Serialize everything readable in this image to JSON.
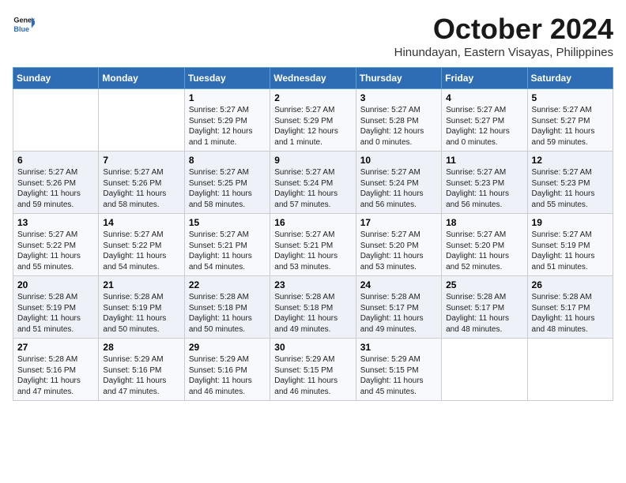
{
  "logo": {
    "line1": "General",
    "line2": "Blue"
  },
  "title": "October 2024",
  "subtitle": "Hinundayan, Eastern Visayas, Philippines",
  "days_of_week": [
    "Sunday",
    "Monday",
    "Tuesday",
    "Wednesday",
    "Thursday",
    "Friday",
    "Saturday"
  ],
  "weeks": [
    [
      {
        "day": "",
        "content": ""
      },
      {
        "day": "",
        "content": ""
      },
      {
        "day": "1",
        "content": "Sunrise: 5:27 AM\nSunset: 5:29 PM\nDaylight: 12 hours and 1 minute."
      },
      {
        "day": "2",
        "content": "Sunrise: 5:27 AM\nSunset: 5:29 PM\nDaylight: 12 hours and 1 minute."
      },
      {
        "day": "3",
        "content": "Sunrise: 5:27 AM\nSunset: 5:28 PM\nDaylight: 12 hours and 0 minutes."
      },
      {
        "day": "4",
        "content": "Sunrise: 5:27 AM\nSunset: 5:27 PM\nDaylight: 12 hours and 0 minutes."
      },
      {
        "day": "5",
        "content": "Sunrise: 5:27 AM\nSunset: 5:27 PM\nDaylight: 11 hours and 59 minutes."
      }
    ],
    [
      {
        "day": "6",
        "content": "Sunrise: 5:27 AM\nSunset: 5:26 PM\nDaylight: 11 hours and 59 minutes."
      },
      {
        "day": "7",
        "content": "Sunrise: 5:27 AM\nSunset: 5:26 PM\nDaylight: 11 hours and 58 minutes."
      },
      {
        "day": "8",
        "content": "Sunrise: 5:27 AM\nSunset: 5:25 PM\nDaylight: 11 hours and 58 minutes."
      },
      {
        "day": "9",
        "content": "Sunrise: 5:27 AM\nSunset: 5:24 PM\nDaylight: 11 hours and 57 minutes."
      },
      {
        "day": "10",
        "content": "Sunrise: 5:27 AM\nSunset: 5:24 PM\nDaylight: 11 hours and 56 minutes."
      },
      {
        "day": "11",
        "content": "Sunrise: 5:27 AM\nSunset: 5:23 PM\nDaylight: 11 hours and 56 minutes."
      },
      {
        "day": "12",
        "content": "Sunrise: 5:27 AM\nSunset: 5:23 PM\nDaylight: 11 hours and 55 minutes."
      }
    ],
    [
      {
        "day": "13",
        "content": "Sunrise: 5:27 AM\nSunset: 5:22 PM\nDaylight: 11 hours and 55 minutes."
      },
      {
        "day": "14",
        "content": "Sunrise: 5:27 AM\nSunset: 5:22 PM\nDaylight: 11 hours and 54 minutes."
      },
      {
        "day": "15",
        "content": "Sunrise: 5:27 AM\nSunset: 5:21 PM\nDaylight: 11 hours and 54 minutes."
      },
      {
        "day": "16",
        "content": "Sunrise: 5:27 AM\nSunset: 5:21 PM\nDaylight: 11 hours and 53 minutes."
      },
      {
        "day": "17",
        "content": "Sunrise: 5:27 AM\nSunset: 5:20 PM\nDaylight: 11 hours and 53 minutes."
      },
      {
        "day": "18",
        "content": "Sunrise: 5:27 AM\nSunset: 5:20 PM\nDaylight: 11 hours and 52 minutes."
      },
      {
        "day": "19",
        "content": "Sunrise: 5:27 AM\nSunset: 5:19 PM\nDaylight: 11 hours and 51 minutes."
      }
    ],
    [
      {
        "day": "20",
        "content": "Sunrise: 5:28 AM\nSunset: 5:19 PM\nDaylight: 11 hours and 51 minutes."
      },
      {
        "day": "21",
        "content": "Sunrise: 5:28 AM\nSunset: 5:19 PM\nDaylight: 11 hours and 50 minutes."
      },
      {
        "day": "22",
        "content": "Sunrise: 5:28 AM\nSunset: 5:18 PM\nDaylight: 11 hours and 50 minutes."
      },
      {
        "day": "23",
        "content": "Sunrise: 5:28 AM\nSunset: 5:18 PM\nDaylight: 11 hours and 49 minutes."
      },
      {
        "day": "24",
        "content": "Sunrise: 5:28 AM\nSunset: 5:17 PM\nDaylight: 11 hours and 49 minutes."
      },
      {
        "day": "25",
        "content": "Sunrise: 5:28 AM\nSunset: 5:17 PM\nDaylight: 11 hours and 48 minutes."
      },
      {
        "day": "26",
        "content": "Sunrise: 5:28 AM\nSunset: 5:17 PM\nDaylight: 11 hours and 48 minutes."
      }
    ],
    [
      {
        "day": "27",
        "content": "Sunrise: 5:28 AM\nSunset: 5:16 PM\nDaylight: 11 hours and 47 minutes."
      },
      {
        "day": "28",
        "content": "Sunrise: 5:29 AM\nSunset: 5:16 PM\nDaylight: 11 hours and 47 minutes."
      },
      {
        "day": "29",
        "content": "Sunrise: 5:29 AM\nSunset: 5:16 PM\nDaylight: 11 hours and 46 minutes."
      },
      {
        "day": "30",
        "content": "Sunrise: 5:29 AM\nSunset: 5:15 PM\nDaylight: 11 hours and 46 minutes."
      },
      {
        "day": "31",
        "content": "Sunrise: 5:29 AM\nSunset: 5:15 PM\nDaylight: 11 hours and 45 minutes."
      },
      {
        "day": "",
        "content": ""
      },
      {
        "day": "",
        "content": ""
      }
    ]
  ]
}
